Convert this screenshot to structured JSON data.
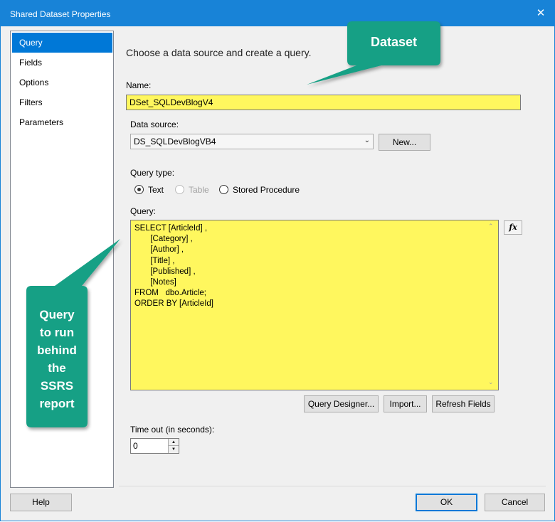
{
  "window": {
    "title": "Shared Dataset Properties"
  },
  "nav": {
    "items": [
      {
        "label": "Query",
        "selected": true
      },
      {
        "label": "Fields",
        "selected": false
      },
      {
        "label": "Options",
        "selected": false
      },
      {
        "label": "Filters",
        "selected": false
      },
      {
        "label": "Parameters",
        "selected": false
      }
    ]
  },
  "main": {
    "heading": "Choose a data source and create a query.",
    "name_label": "Name:",
    "name_value": "DSet_SQLDevBlogV4",
    "datasource_label": "Data source:",
    "datasource_value": "DS_SQLDevBlogVB4",
    "new_button": "New...",
    "query_type_label": "Query type:",
    "query_types": [
      {
        "label": "Text",
        "checked": true,
        "enabled": true
      },
      {
        "label": "Table",
        "checked": false,
        "enabled": false
      },
      {
        "label": "Stored Procedure",
        "checked": false,
        "enabled": true
      }
    ],
    "query_label": "Query:",
    "query_lines": [
      "SELECT [ArticleId] ,",
      "       [Category] ,",
      "       [Author] ,",
      "       [Title] ,",
      "       [Published] ,",
      "       [Notes]",
      "FROM   dbo.Article;",
      "ORDER BY [ArticleId]"
    ],
    "fx_button": "fx",
    "query_designer_button": "Query Designer...",
    "import_button": "Import...",
    "refresh_fields_button": "Refresh Fields",
    "timeout_label": "Time out (in seconds):",
    "timeout_value": "0"
  },
  "footer": {
    "help_button": "Help",
    "ok_button": "OK",
    "cancel_button": "Cancel"
  },
  "callouts": {
    "dataset": "Dataset",
    "query_lines": [
      "Query",
      "to run",
      "behind",
      "the",
      "SSRS",
      "report"
    ],
    "color": "#16a085"
  },
  "colors": {
    "titlebar": "#1883d7",
    "selection": "#0078d7",
    "highlight": "#fff75e"
  }
}
